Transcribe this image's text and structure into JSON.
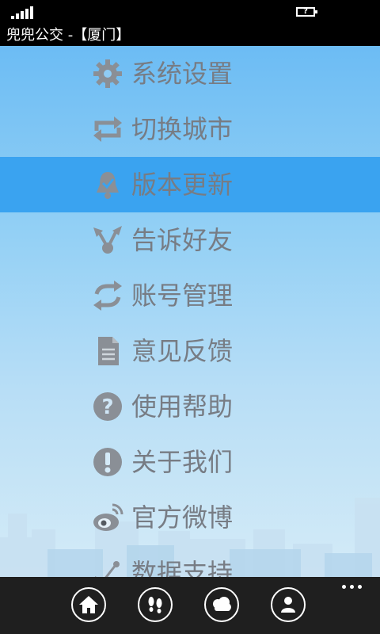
{
  "status": {
    "battery_label": "?"
  },
  "title": "兜兜公交 -【厦门】",
  "menu": [
    {
      "label": "系统设置",
      "icon": "gear-icon"
    },
    {
      "label": "切换城市",
      "icon": "switch-arrows-icon"
    },
    {
      "label": "版本更新",
      "icon": "bell-icon",
      "active": true
    },
    {
      "label": "告诉好友",
      "icon": "share-icon"
    },
    {
      "label": "账号管理",
      "icon": "sync-icon"
    },
    {
      "label": "意见反馈",
      "icon": "document-icon"
    },
    {
      "label": "使用帮助",
      "icon": "help-icon"
    },
    {
      "label": "关于我们",
      "icon": "exclamation-icon"
    },
    {
      "label": "官方微博",
      "icon": "weibo-icon"
    },
    {
      "label": "数据支持",
      "icon": "satellite-icon"
    }
  ],
  "appbar": {
    "buttons": [
      "home-icon",
      "footprints-icon",
      "weather-icon",
      "user-icon"
    ]
  },
  "colors": {
    "active_row": "#3aa3f0",
    "label": "#777c84",
    "icon": "#8a8f96"
  }
}
